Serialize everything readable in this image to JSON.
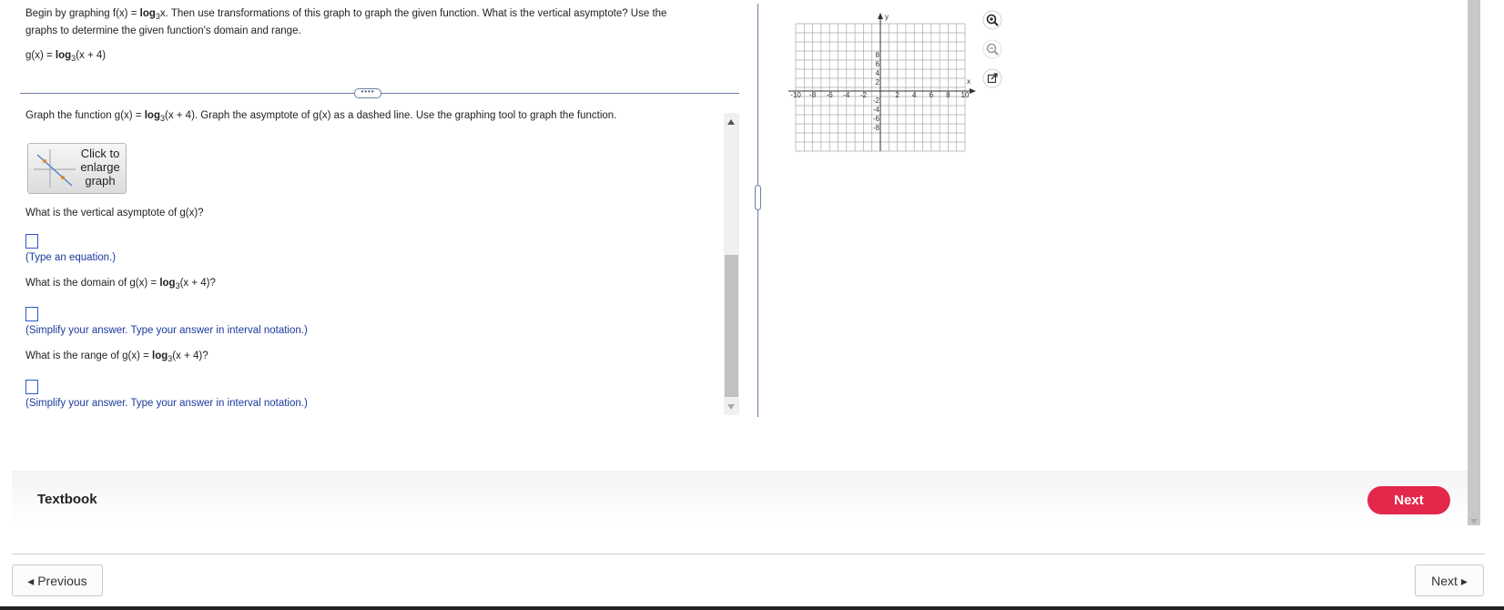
{
  "question": {
    "intro_part1": "Begin by graphing f(x) = ",
    "intro_log": "log",
    "intro_base": "3",
    "intro_part2": "x. Then use transformations of this graph to graph the given function. What is the vertical asymptote? Use the",
    "intro_line2": "graphs to determine the given function's domain and range.",
    "given_prefix": "g(x) = ",
    "given_log": "log",
    "given_base": "3",
    "given_arg": "(x + 4)"
  },
  "instructions": {
    "part1": "Graph the function g(x) = ",
    "log": "log",
    "base": "3",
    "part2": "(x + 4).  Graph the asymptote of g(x) as a dashed line. Use the graphing tool to graph the function."
  },
  "enlarge_button": {
    "label_line1": "Click to",
    "label_line2": "enlarge",
    "label_line3": "graph"
  },
  "q_asymptote": {
    "prompt": "What is the vertical asymptote of g(x)?",
    "hint": "(Type an equation.)"
  },
  "q_domain": {
    "prompt_prefix": "What is the domain of g(x) = ",
    "log": "log",
    "base": "3",
    "prompt_suffix": "(x + 4)?",
    "hint": "(Simplify your answer. Type your answer in interval notation.)"
  },
  "q_range": {
    "prompt_prefix": "What is the range of g(x) = ",
    "log": "log",
    "base": "3",
    "prompt_suffix": "(x + 4)?",
    "hint": "(Simplify your answer. Type your answer in interval notation.)"
  },
  "divider_handle": "••••",
  "graph": {
    "x_axis_label": "x",
    "y_axis_label": "y",
    "x_ticks": [
      "-10",
      "-8",
      "-6",
      "-4",
      "-2",
      "2",
      "4",
      "6",
      "8",
      "10"
    ],
    "y_ticks": [
      "8",
      "6",
      "4",
      "2",
      "-2",
      "-4",
      "-6",
      "-8"
    ],
    "range": [
      -10,
      10
    ]
  },
  "tools": {
    "zoom_in_icon": "zoom-in-icon",
    "zoom_out_icon": "zoom-out-icon",
    "popout_icon": "external-link-icon"
  },
  "footer": {
    "textbook_label": "Textbook",
    "next_primary": "Next",
    "previous_label": "◂ Previous",
    "next_label": "Next ▸"
  },
  "colors": {
    "accent": "#e3284b",
    "answer_box": "#2b5cc4",
    "hint_text": "#1a3a9c"
  }
}
